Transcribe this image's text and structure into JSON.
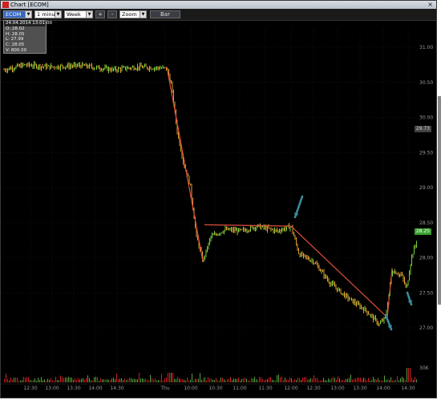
{
  "window": {
    "title": "Chart [ECOM]",
    "close_glyph": "×"
  },
  "toolbar": {
    "symbol": "ECOM",
    "interval": "1 minute",
    "range": "Week",
    "zoom_in": "+",
    "zoom_out": "-",
    "zoom": "Zoom",
    "bar": "Bar"
  },
  "info": {
    "header": "24.04.2014 13:01:00",
    "open": "O: 28.02",
    "high": "H: 28.05",
    "low": "L: 27.99",
    "close": "C: 28.05",
    "volume": "V: 800.00"
  },
  "price_axis": [
    "31.00",
    "30.50",
    "30.00",
    "29.50",
    "29.00",
    "28.50",
    "28.00",
    "27.50",
    "27.00"
  ],
  "price_tags": {
    "current": "28.25",
    "marker": "29.73"
  },
  "volume_axis": "30K",
  "time_axis": [
    "12:30",
    "13:00",
    "13:30",
    "14:00",
    "14:30",
    "Thu",
    "10:00",
    "10:30",
    "11:00",
    "11:30",
    "12:00",
    "12:30",
    "13:00",
    "13:30",
    "14:00",
    "14:30"
  ],
  "colors": {
    "background": "#000000",
    "up": "#7ccf3a",
    "down": "#e0a030",
    "trendline": "#e0503a",
    "arrow": "#3b8a9a",
    "volume": "#cc2222",
    "grid": "#1c2a1c"
  }
}
